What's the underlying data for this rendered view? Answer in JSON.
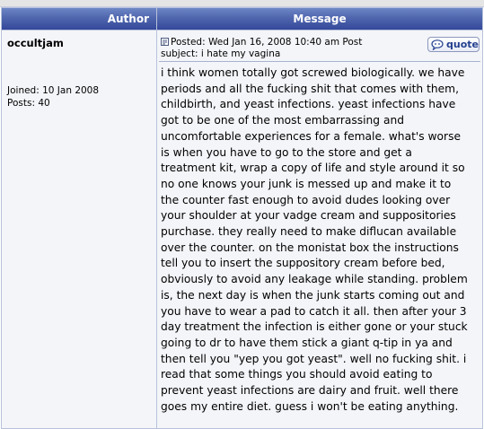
{
  "header": {
    "author_label": "Author",
    "message_label": "Message"
  },
  "author": {
    "name": "occultjam",
    "joined": "Joined: 10 Jan 2008",
    "posts": "Posts: 40"
  },
  "post": {
    "posted_line": "Posted: Wed Jan 16, 2008 10:40 am    Post",
    "subject_line": "subject: i hate my vagina",
    "quote_label": "quote",
    "icons": {
      "post_icon": "post-document-icon",
      "quote_icon": "speech-bubble-icon"
    },
    "body_lines": [
      "i think women totally got screwed biologically. we have",
      "periods and all the fucking shit that comes with them,",
      "childbirth, and yeast infections. yeast infections have",
      "got to be one of the most embarrassing and",
      "uncomfortable experiences for a female. what's worse",
      "is when you have to go to the store and get a",
      "treatment kit, wrap a copy of life and style around it so",
      "no one knows your junk is messed up and make it to",
      "the counter fast enough to avoid dudes looking over",
      "your shoulder at your vadge cream and suppositories",
      "purchase. they really need to make diflucan available",
      "over the counter. on the monistat box the instructions",
      "tell you to insert the suppository cream before bed,",
      "obviously to avoid any leakage while standing. problem",
      "is, the next day is when the junk starts coming out and",
      "you have to wear a pad to catch it all. then after your 3",
      "day treatment the infection is either gone or your stuck",
      "going to dr to have them stick a giant q-tip in ya and",
      "then tell you \"yep you got yeast\". well no fucking shit. i",
      "read that some things you should avoid eating to",
      "prevent yeast infections are dairy and fruit. well there",
      "goes my entire diet. guess i won't be eating anything."
    ]
  },
  "colors": {
    "header_gradient_top": "#6e87c5",
    "header_gradient_bottom": "#34489a",
    "row_background": "#f4f5f9",
    "border": "#b8c2db",
    "quote_text": "#24408f"
  }
}
